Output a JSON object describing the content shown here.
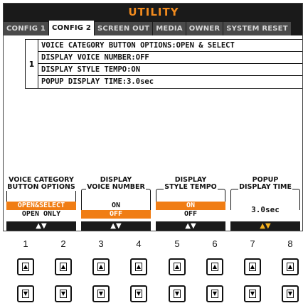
{
  "screen": {
    "title": "UTILITY",
    "tabs": [
      {
        "label": "CONFIG 1",
        "active": false
      },
      {
        "label": "CONFIG 2",
        "active": true
      },
      {
        "label": "SCREEN OUT",
        "active": false
      },
      {
        "label": "MEDIA",
        "active": false
      },
      {
        "label": "OWNER",
        "active": false
      },
      {
        "label": "SYSTEM RESET",
        "active": false
      }
    ]
  },
  "settings": {
    "index": "1",
    "rows": [
      "VOICE CATEGORY BUTTON OPTIONS:OPEN & SELECT",
      "DISPLAY VOICE NUMBER:OFF",
      "DISPLAY STYLE TEMPO:ON",
      "POPUP DISPLAY TIME:3.0sec"
    ]
  },
  "functions": [
    {
      "label_line1": "VOICE CATEGORY",
      "label_line2": "BUTTON OPTIONS",
      "options": [
        "OPEN&SELECT",
        "OPEN ONLY"
      ],
      "selected": 0
    },
    {
      "label_line1": "DISPLAY",
      "label_line2": "VOICE NUMBER",
      "options": [
        "ON",
        "OFF"
      ],
      "selected": 1
    },
    {
      "label_line1": "DISPLAY",
      "label_line2": "STYLE TEMPO",
      "options": [
        "ON",
        "OFF"
      ],
      "selected": 0
    },
    {
      "label_line1": "POPUP",
      "label_line2": "DISPLAY TIME",
      "value": "3.0sec"
    }
  ],
  "arrow_bars": [
    {
      "glyph": "▲▼",
      "highlight": false
    },
    {
      "glyph": "▲▼",
      "highlight": false
    },
    {
      "glyph": "▲▼",
      "highlight": false
    },
    {
      "glyph": "▲▼",
      "highlight": true
    }
  ],
  "buttons": {
    "numbers": [
      "1",
      "2",
      "3",
      "4",
      "5",
      "6",
      "7",
      "8"
    ],
    "up_glyph": "▲",
    "down_glyph": "▼"
  },
  "colors": {
    "accent": "#f07d14",
    "lcd_dark": "#1a1a1a",
    "title_text": "#f08a1e"
  }
}
